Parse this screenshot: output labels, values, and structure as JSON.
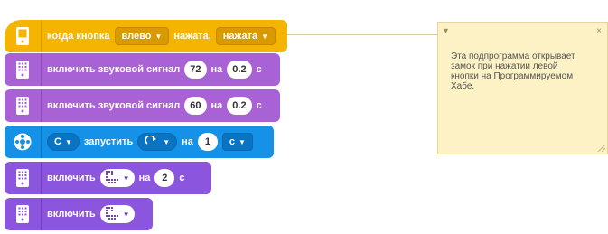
{
  "colors": {
    "event": "#f5b400",
    "event_dark": "#d89a00",
    "sound": "#a862d6",
    "sound_dark": "#8f4bbf",
    "motor": "#1591e8",
    "motor_dark": "#0b74c2",
    "light": "#8c55dd",
    "light_dark": "#7340c2"
  },
  "blocks": {
    "hat": {
      "label_when": "когда кнопка",
      "button_choice": "влево",
      "label_pressed": "нажата,",
      "state_choice": "нажата",
      "icon": "hub-brick-icon"
    },
    "sound1": {
      "label": "включить звуковой сигнал",
      "freq": "72",
      "on": "на",
      "duration": "0.2",
      "unit": "с",
      "icon": "hub-sound-icon"
    },
    "sound2": {
      "label": "включить звуковой сигнал",
      "freq": "60",
      "on": "на",
      "duration": "0.2",
      "unit": "с",
      "icon": "hub-sound-icon"
    },
    "motor": {
      "port": "C",
      "label": "запустить",
      "on": "на",
      "amount": "1",
      "unit": "с",
      "icon": "motor-icon"
    },
    "light1": {
      "label": "включить",
      "on": "на",
      "duration": "2",
      "unit": "с",
      "icon": "hub-light-matrix-icon"
    },
    "light2": {
      "label": "включить",
      "icon": "hub-light-matrix-icon"
    }
  },
  "comment": {
    "text": "Эта подпрограмма открывает\nзамок при нажатии левой\nкнопки на Программируемом\nХабе.",
    "collapse_glyph": "▾",
    "close_glyph": "×"
  },
  "glyphs": {
    "caret": "▼"
  }
}
